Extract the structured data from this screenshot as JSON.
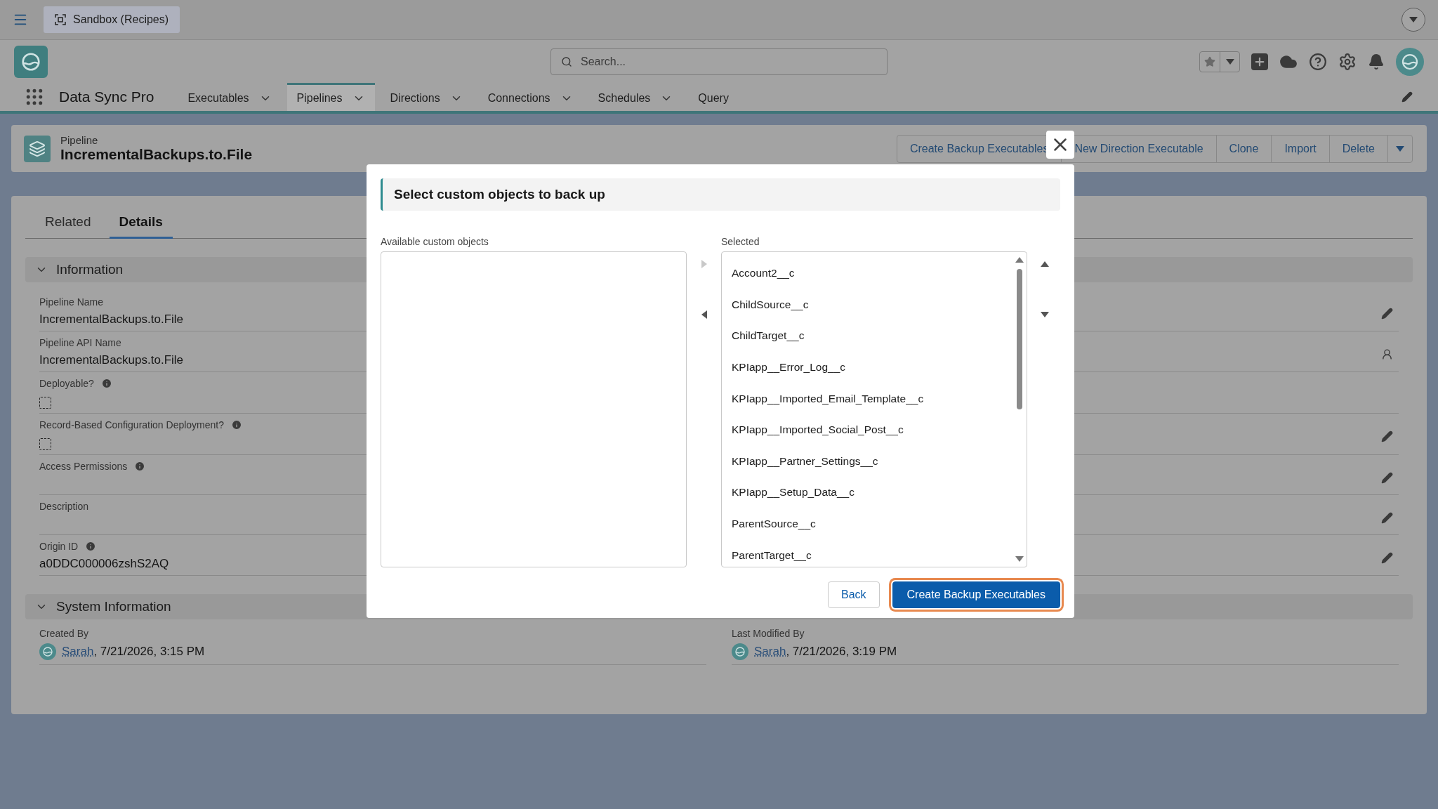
{
  "top_bar": {
    "org_tab": "Sandbox (Recipes)"
  },
  "header": {
    "search": {
      "placeholder": "Search..."
    }
  },
  "app": {
    "name": "Data Sync Pro",
    "nav": [
      {
        "label": "Executables",
        "selected": false,
        "has_menu": true
      },
      {
        "label": "Pipelines",
        "selected": true,
        "has_menu": true
      },
      {
        "label": "Directions",
        "selected": false,
        "has_menu": true
      },
      {
        "label": "Connections",
        "selected": false,
        "has_menu": true
      },
      {
        "label": "Schedules",
        "selected": false,
        "has_menu": true
      },
      {
        "label": "Query",
        "selected": false,
        "has_menu": false
      }
    ]
  },
  "record": {
    "type": "Pipeline",
    "title": "IncrementalBackups.to.File",
    "actions": [
      "Create Backup Executables",
      "New Direction Executable",
      "Clone",
      "Import",
      "Delete"
    ]
  },
  "tabs": [
    {
      "label": "Related",
      "selected": false
    },
    {
      "label": "Details",
      "selected": true
    }
  ],
  "sections": [
    {
      "title": "Information",
      "expanded": true,
      "fields": [
        {
          "kind": "text",
          "label": "Pipeline Name",
          "value": "IncrementalBackups.to.File",
          "info": false,
          "editable": true,
          "owner_change": false
        },
        {
          "kind": "text",
          "label": "Pipeline API Name",
          "value": "IncrementalBackups.to.File",
          "info": false,
          "editable": false,
          "owner_change": true
        },
        {
          "kind": "checkbox",
          "label": "Deployable?",
          "checked": false,
          "info": true,
          "editable": false,
          "owner_change": false
        },
        {
          "kind": "checkbox",
          "label": "Record-Based Configuration Deployment?",
          "checked": false,
          "info": true,
          "editable": true,
          "owner_change": false
        },
        {
          "kind": "text",
          "label": "Access Permissions",
          "info": true,
          "editable": true,
          "owner_change": false
        },
        {
          "kind": "text",
          "label": "Description",
          "info": false,
          "editable": true,
          "owner_change": false
        },
        {
          "kind": "text",
          "label": "Origin ID",
          "value": "a0DDC000006zshS2AQ",
          "info": true,
          "editable": true,
          "owner_change": false
        }
      ]
    },
    {
      "title": "System Information",
      "expanded": true,
      "fields": [
        {
          "kind": "user",
          "label": "Created By",
          "user": "Sarah",
          "value": ", 7/21/2026, 3:15 PM"
        },
        {
          "kind": "user",
          "label": "Last Modified By",
          "user": "Sarah",
          "value": ", 7/21/2026, 3:19 PM"
        }
      ]
    }
  ],
  "modal": {
    "title": "Select custom objects to back up",
    "available_label": "Available custom objects",
    "selected_label": "Selected",
    "selected_items": [
      "Account2__c",
      "ChildSource__c",
      "ChildTarget__c",
      "KPIapp__Error_Log__c",
      "KPIapp__Imported_Email_Template__c",
      "KPIapp__Imported_Social_Post__c",
      "KPIapp__Partner_Settings__c",
      "KPIapp__Setup_Data__c",
      "ParentSource__c",
      "ParentTarget__c"
    ],
    "move_buttons": [
      {
        "kind": "right",
        "disabled": true
      },
      {
        "kind": "left",
        "disabled": false
      }
    ],
    "order_buttons": [
      {
        "kind": "up",
        "disabled": false
      },
      {
        "kind": "down",
        "disabled": false
      }
    ],
    "buttons": [
      {
        "label": "Back",
        "kind": "neutral",
        "focused": false
      },
      {
        "label": "Create Backup Executables",
        "kind": "brand",
        "focused": true
      }
    ]
  }
}
